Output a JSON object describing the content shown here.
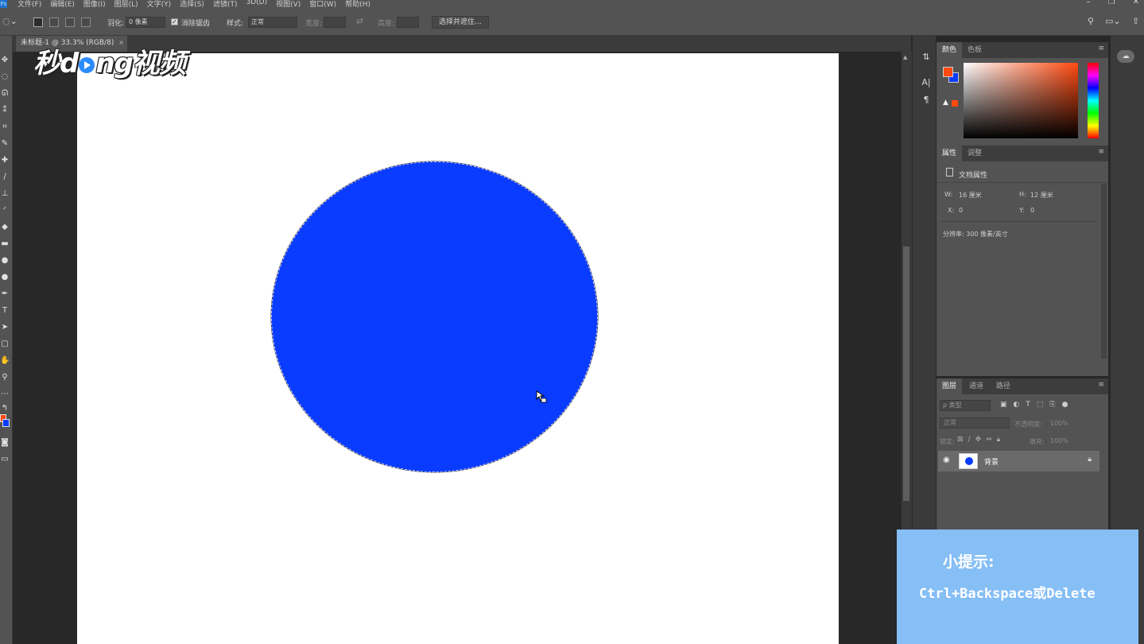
{
  "menu": {
    "items": [
      "文件(F)",
      "编辑(E)",
      "图像(I)",
      "图层(L)",
      "文字(Y)",
      "选择(S)",
      "滤镜(T)",
      "3D(D)",
      "视图(V)",
      "窗口(W)",
      "帮助(H)"
    ],
    "window_controls": [
      "–",
      "❐",
      "✕"
    ]
  },
  "options": {
    "feather_label": "羽化:",
    "feather_value": "0 像素",
    "antialias_label": "消除锯齿",
    "style_label": "样式:",
    "style_value": "正常",
    "width_label": "宽度:",
    "height_label": "高度:",
    "select_mask_button": "选择并遮住..."
  },
  "document": {
    "tab_title": "未标题-1 @ 33.3% (RGB/8)",
    "close": "×"
  },
  "colors": {
    "foreground": "#ff4a10",
    "background": "#0a3cff",
    "circle_fill": "#0a3cff"
  },
  "color_panel": {
    "tabs": [
      "颜色",
      "色板"
    ]
  },
  "properties_panel": {
    "tabs": [
      "属性",
      "调整"
    ],
    "title": "文档属性",
    "w_label": "W:",
    "w_value": "16 厘米",
    "h_label": "H:",
    "h_value": "12 厘米",
    "x_label": "X:",
    "x_value": "0",
    "y_label": "Y:",
    "y_value": "0",
    "resolution": "分辨率: 300 像素/英寸"
  },
  "layers_panel": {
    "tabs": [
      "图层",
      "通道",
      "路径"
    ],
    "filter_placeholder": "ρ 类型",
    "blend_mode": "正常",
    "opacity_label": "不透明度:",
    "opacity_value": "100%",
    "lock_label": "锁定:",
    "fill_label": "填充:",
    "fill_value": "100%",
    "layer_name": "背景"
  },
  "watermark": {
    "logo_part1": "秒d",
    "logo_part2": "ng视频"
  },
  "tip": {
    "title": "小提示:",
    "text": "Ctrl+Backspace或Delete"
  }
}
